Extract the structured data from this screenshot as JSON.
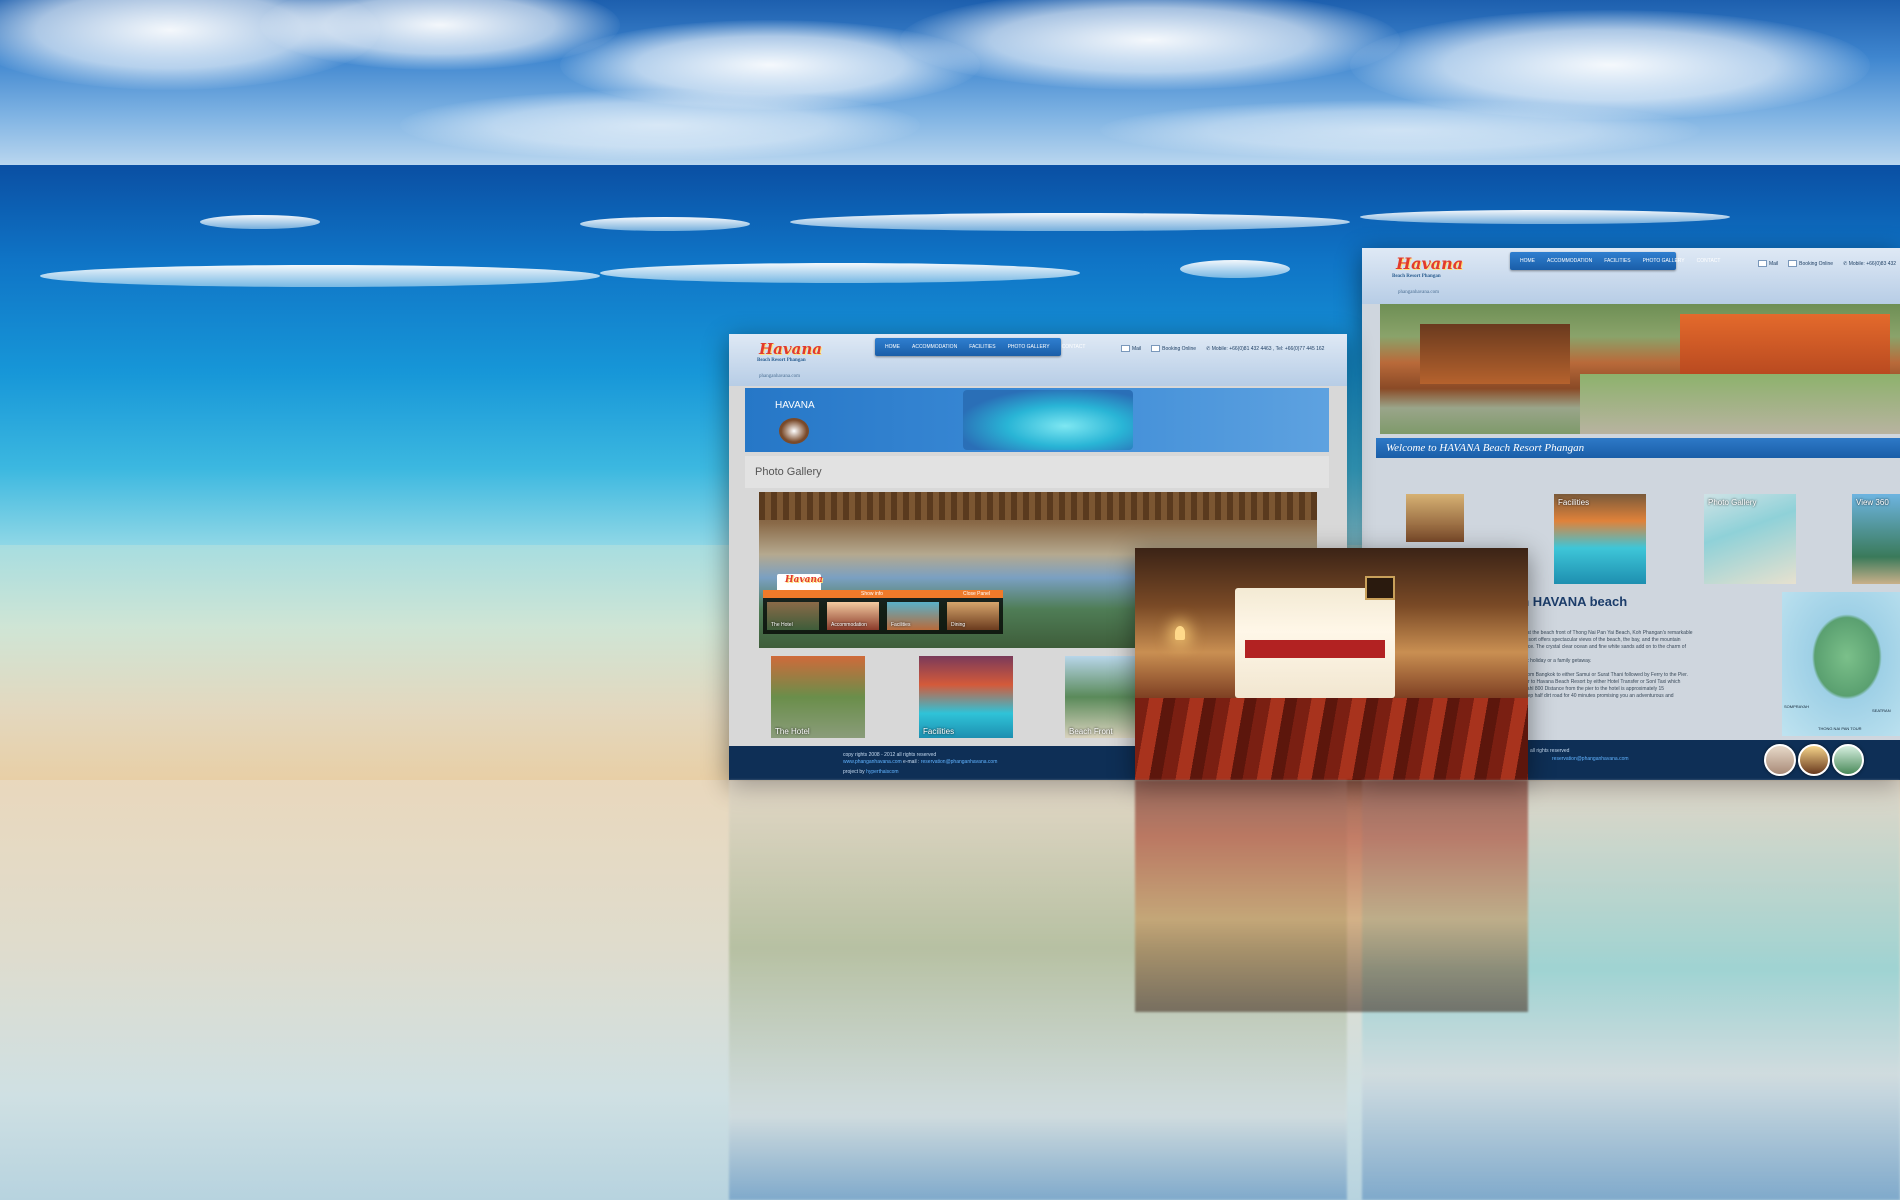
{
  "scene": {
    "title": ""
  },
  "site_brand": {
    "logo": "Havana",
    "tagline": "Beach Resort Phangan",
    "url": "phanganhavana.com"
  },
  "nav": [
    "HOME",
    "ACCOMMODATION",
    "FACILITIES",
    "PHOTO GALLERY",
    "CONTACT"
  ],
  "util": {
    "mail": "Mail",
    "booking": "Booking Online",
    "mobile": "Mobile: +66(0)81 432 4463 , Tel: +66(0)77 445 162",
    "mobile_short": "Mobile: +66(0)83 432"
  },
  "gallery_page": {
    "banner_text": "HAVANA",
    "heading": "Photo Gallery",
    "bar_labels": [
      "The Hotel",
      "Accommodation",
      "Facilities",
      "Dining"
    ],
    "bar_tabs": [
      "Show info",
      "Close Panel"
    ],
    "thumbs": [
      "The Hotel",
      "Facilities",
      "Beach Front"
    ],
    "footer": {
      "copy": "copy rights 2008 - 2012 all rights reserved",
      "site": "www.phanganhavana.com",
      "email_label": "e-mail :",
      "email": "reservation@phanganhavana.com",
      "project_label": "project by",
      "project": "hyperthaiscom"
    }
  },
  "home_page": {
    "welcome": "Welcome to HAVANA Beach Resort Phangan",
    "tiles": [
      "Facilities",
      "Photo Gallery",
      "View 360"
    ],
    "heading_partial": "an HAVANA beach",
    "body_lines": [
      "mfort at the beach front of Thong Nai Pan Yai Beach, Koh Phangan's remarkable",
      "The resort offers spectacular views of the beach, the bay, and the mountain",
      "perience. The crystal clear ocean and fine white sands add on to the charm of",
      "",
      "mantic holiday or a family getaway.",
      "",
      "ows from Bangkok to either Samui or Surat Thani followed by Ferry to the Pier.",
      "ransfer to Havana Beach Resort by either Hotel Transfer or Sonl Taxi which",
      "s at Bahl 800 Distance from the pier to the hotel is approximately 15",
      "nd steep half dirt road for 40 minutes promising you an adventurous and"
    ],
    "map_labels": [
      "SOMPRAYAH",
      "THONG NAI PAN TOUR",
      "SEATRAN"
    ],
    "footer": {
      "copy": "all rights reserved",
      "email": "reservation@phanganhavana.com"
    }
  },
  "colors": {
    "accent": "#1a5ea8",
    "footer": "#0e2f56",
    "link": "#61b3ff"
  }
}
